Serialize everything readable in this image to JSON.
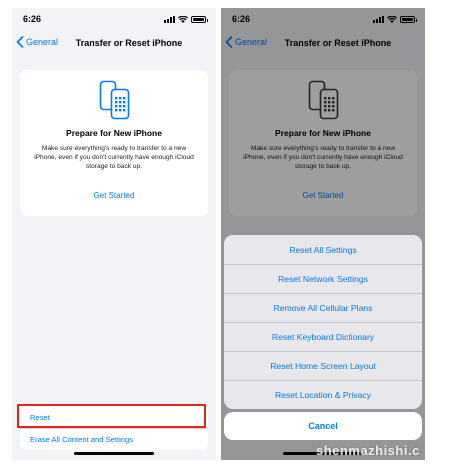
{
  "status_bar": {
    "time": "6:26"
  },
  "nav": {
    "back_label": "General",
    "title": "Transfer or Reset iPhone"
  },
  "card": {
    "title": "Prepare for New iPhone",
    "description": "Make sure everything's ready to transfer to a new iPhone, even if you don't currently have enough iCloud storage to back up.",
    "link_label": "Get Started"
  },
  "list": {
    "items": [
      "Reset",
      "Erase All Content and Settings"
    ]
  },
  "action_sheet": {
    "items": [
      "Reset All Settings",
      "Reset Network Settings",
      "Remove All Cellular Plans",
      "Reset Keyboard Dictionary",
      "Reset Home Screen Layout",
      "Reset Location & Privacy"
    ],
    "cancel_label": "Cancel"
  },
  "watermark": "shenmazhishi.c",
  "colors": {
    "accent": "#007aff",
    "highlight": "#e0261b",
    "background": "#f2f2f7"
  },
  "icons": [
    "chevron-left-icon",
    "signal-icon",
    "wifi-icon",
    "battery-icon",
    "phones-transfer-icon"
  ]
}
